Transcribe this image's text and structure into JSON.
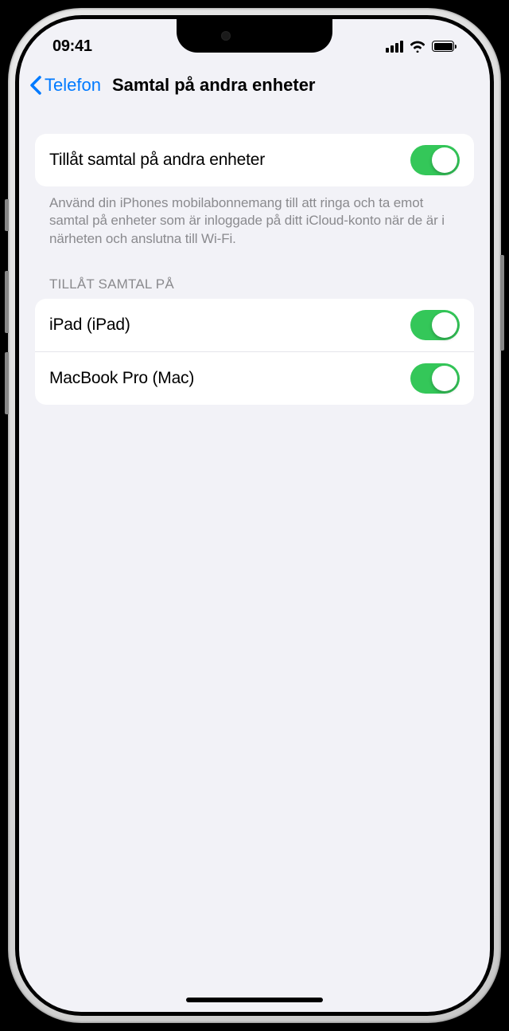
{
  "status": {
    "time": "09:41"
  },
  "nav": {
    "back_label": "Telefon",
    "title": "Samtal på andra enheter"
  },
  "main_toggle": {
    "label": "Tillåt samtal på andra enheter",
    "enabled": true
  },
  "footer": "Använd din iPhones mobilabonnemang till att ringa och ta emot samtal på enheter som är inloggade på ditt iCloud-konto när de är i närheten och anslutna till Wi-Fi.",
  "section_header": "TILLÅT SAMTAL PÅ",
  "devices": [
    {
      "label": "iPad (iPad)",
      "enabled": true
    },
    {
      "label": "MacBook Pro (Mac)",
      "enabled": true
    }
  ]
}
